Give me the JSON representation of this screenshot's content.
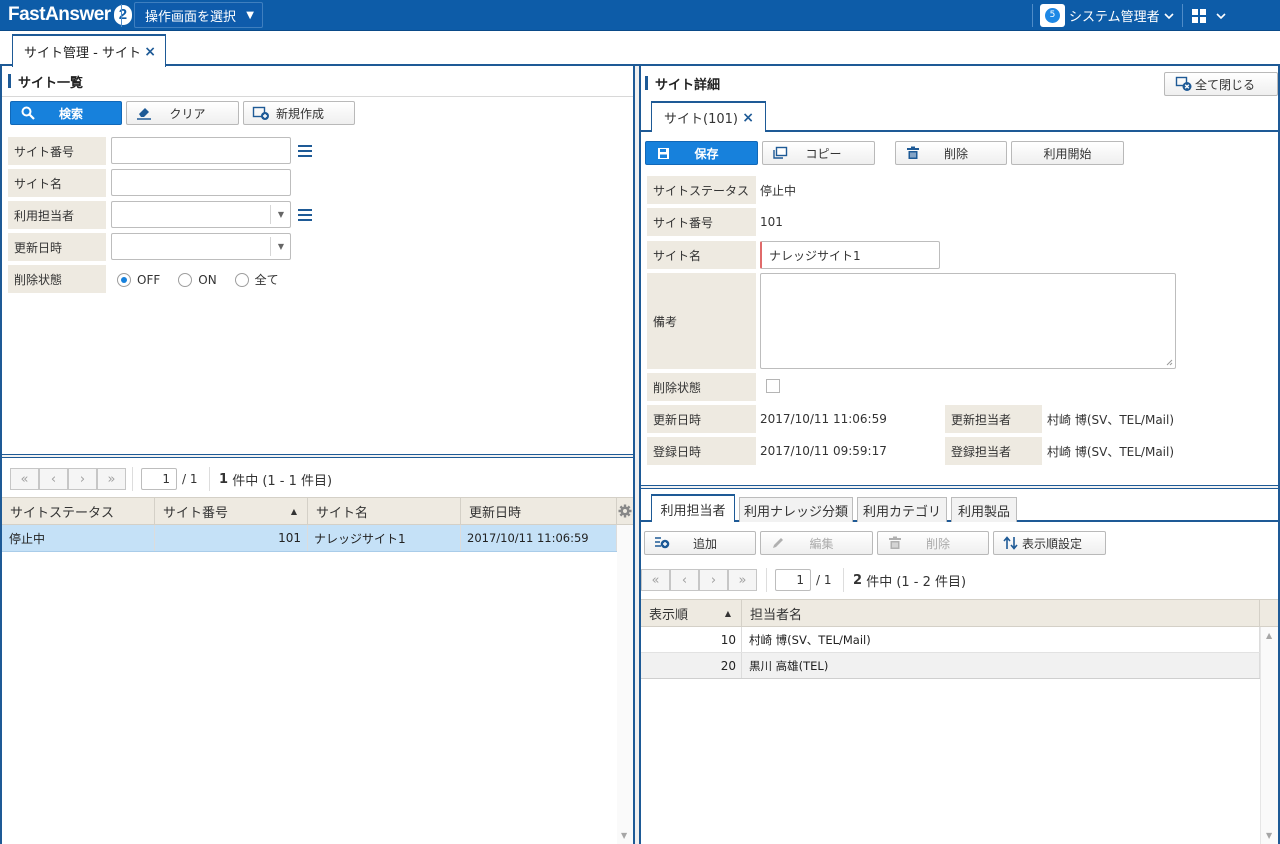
{
  "app": {
    "logo_text": "FastAnswer",
    "logo_version": "2",
    "screen_select_label": "操作画面を選択",
    "user_badge": "5",
    "user_name": "システム管理者"
  },
  "main_tab": {
    "label": "サイト管理 - サイト",
    "close": "×"
  },
  "left": {
    "title": "サイト一覧",
    "buttons": {
      "search": "検索",
      "clear": "クリア",
      "create": "新規作成"
    },
    "fields": {
      "site_number": "サイト番号",
      "site_name": "サイト名",
      "user": "利用担当者",
      "updated": "更新日時",
      "deleted": "削除状態"
    },
    "radio": {
      "off": "OFF",
      "on": "ON",
      "all": "全て",
      "selected": "OFF"
    },
    "pager": {
      "page": "1",
      "total": "/ 1",
      "count_bold": "1",
      "count_text": "件中 (1 - 1 件目)"
    },
    "table": {
      "headers": [
        "サイトステータス",
        "サイト番号",
        "サイト名",
        "更新日時"
      ],
      "rows": [
        {
          "status": "停止中",
          "number": "101",
          "name": "ナレッジサイト1",
          "updated": "2017/10/11 11:06:59"
        }
      ]
    }
  },
  "right": {
    "title": "サイト詳細",
    "close_all": "全て閉じる",
    "detail_tab": {
      "label": "サイト(101)",
      "close": "×"
    },
    "buttons": {
      "save": "保存",
      "copy": "コピー",
      "delete": "削除",
      "start": "利用開始"
    },
    "fields": {
      "status_label": "サイトステータス",
      "status_value": "停止中",
      "number_label": "サイト番号",
      "number_value": "101",
      "name_label": "サイト名",
      "name_value": "ナレッジサイト1",
      "note_label": "備考",
      "deleted_label": "削除状態",
      "updated_label": "更新日時",
      "updated_value": "2017/10/11 11:06:59",
      "updated_by_label": "更新担当者",
      "updated_by_value": "村崎 博(SV、TEL/Mail)",
      "created_label": "登録日時",
      "created_value": "2017/10/11 09:59:17",
      "created_by_label": "登録担当者",
      "created_by_value": "村崎 博(SV、TEL/Mail)"
    },
    "subtabs": [
      "利用担当者",
      "利用ナレッジ分類",
      "利用カテゴリ",
      "利用製品"
    ],
    "sub_buttons": {
      "add": "追加",
      "edit": "編集",
      "delete": "削除",
      "order": "表示順設定"
    },
    "pager": {
      "page": "1",
      "total": "/ 1",
      "count_bold": "2",
      "count_text": "件中 (1 - 2 件目)"
    },
    "table": {
      "headers": [
        "表示順",
        "担当者名"
      ],
      "rows": [
        {
          "order": "10",
          "name": "村崎 博(SV、TEL/Mail)"
        },
        {
          "order": "20",
          "name": "黒川 高雄(TEL)"
        }
      ]
    }
  },
  "colors": {
    "brand": "#0d5ca8",
    "primary": "#1781dc",
    "selected_row": "#c5e1f7"
  }
}
